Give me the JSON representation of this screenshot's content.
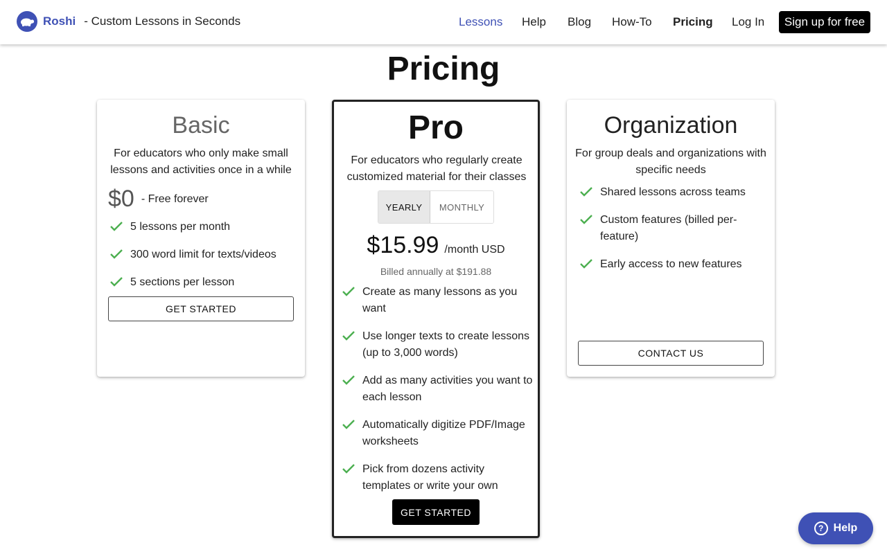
{
  "header": {
    "brand_name": "Roshi",
    "brand_tagline": "- Custom Lessons in Seconds",
    "nav": {
      "lessons": "Lessons",
      "help": "Help",
      "blog": "Blog",
      "howto": "How-To",
      "pricing": "Pricing",
      "login": "Log In"
    },
    "signup_label": "Sign up for free"
  },
  "page_title": "Pricing",
  "plans": {
    "basic": {
      "name": "Basic",
      "description": "For educators who only make small lessons and activities once in a while",
      "price": "$0",
      "price_note": "- Free forever",
      "features": [
        "5 lessons per month",
        "300 word limit for texts/videos",
        "5 sections per lesson"
      ],
      "cta": "GET STARTED"
    },
    "pro": {
      "name": "Pro",
      "description": "For educators who regularly create customized material for their classes",
      "toggle_yearly": "YEARLY",
      "toggle_monthly": "MONTHLY",
      "selected_period": "YEARLY",
      "price": "$15.99",
      "price_unit": "/month USD",
      "billing_note": "Billed annually at $191.88",
      "features": [
        "Create as many lessons as you want",
        "Use longer texts to create lessons (up to 3,000 words)",
        "Add as many activities you want to each lesson",
        "Automatically digitize PDF/Image worksheets",
        "Pick from dozens activity templates or write your own"
      ],
      "cta": "GET STARTED"
    },
    "organization": {
      "name": "Organization",
      "description": "For group deals and organizations with specific needs",
      "features": [
        "Shared lessons across teams",
        "Custom features (billed per-feature)",
        "Early access to new features"
      ],
      "cta": "CONTACT US"
    }
  },
  "help_button": "Help",
  "colors": {
    "brand": "#3f51b5",
    "check": "#4caf50",
    "dark": "#000000"
  }
}
